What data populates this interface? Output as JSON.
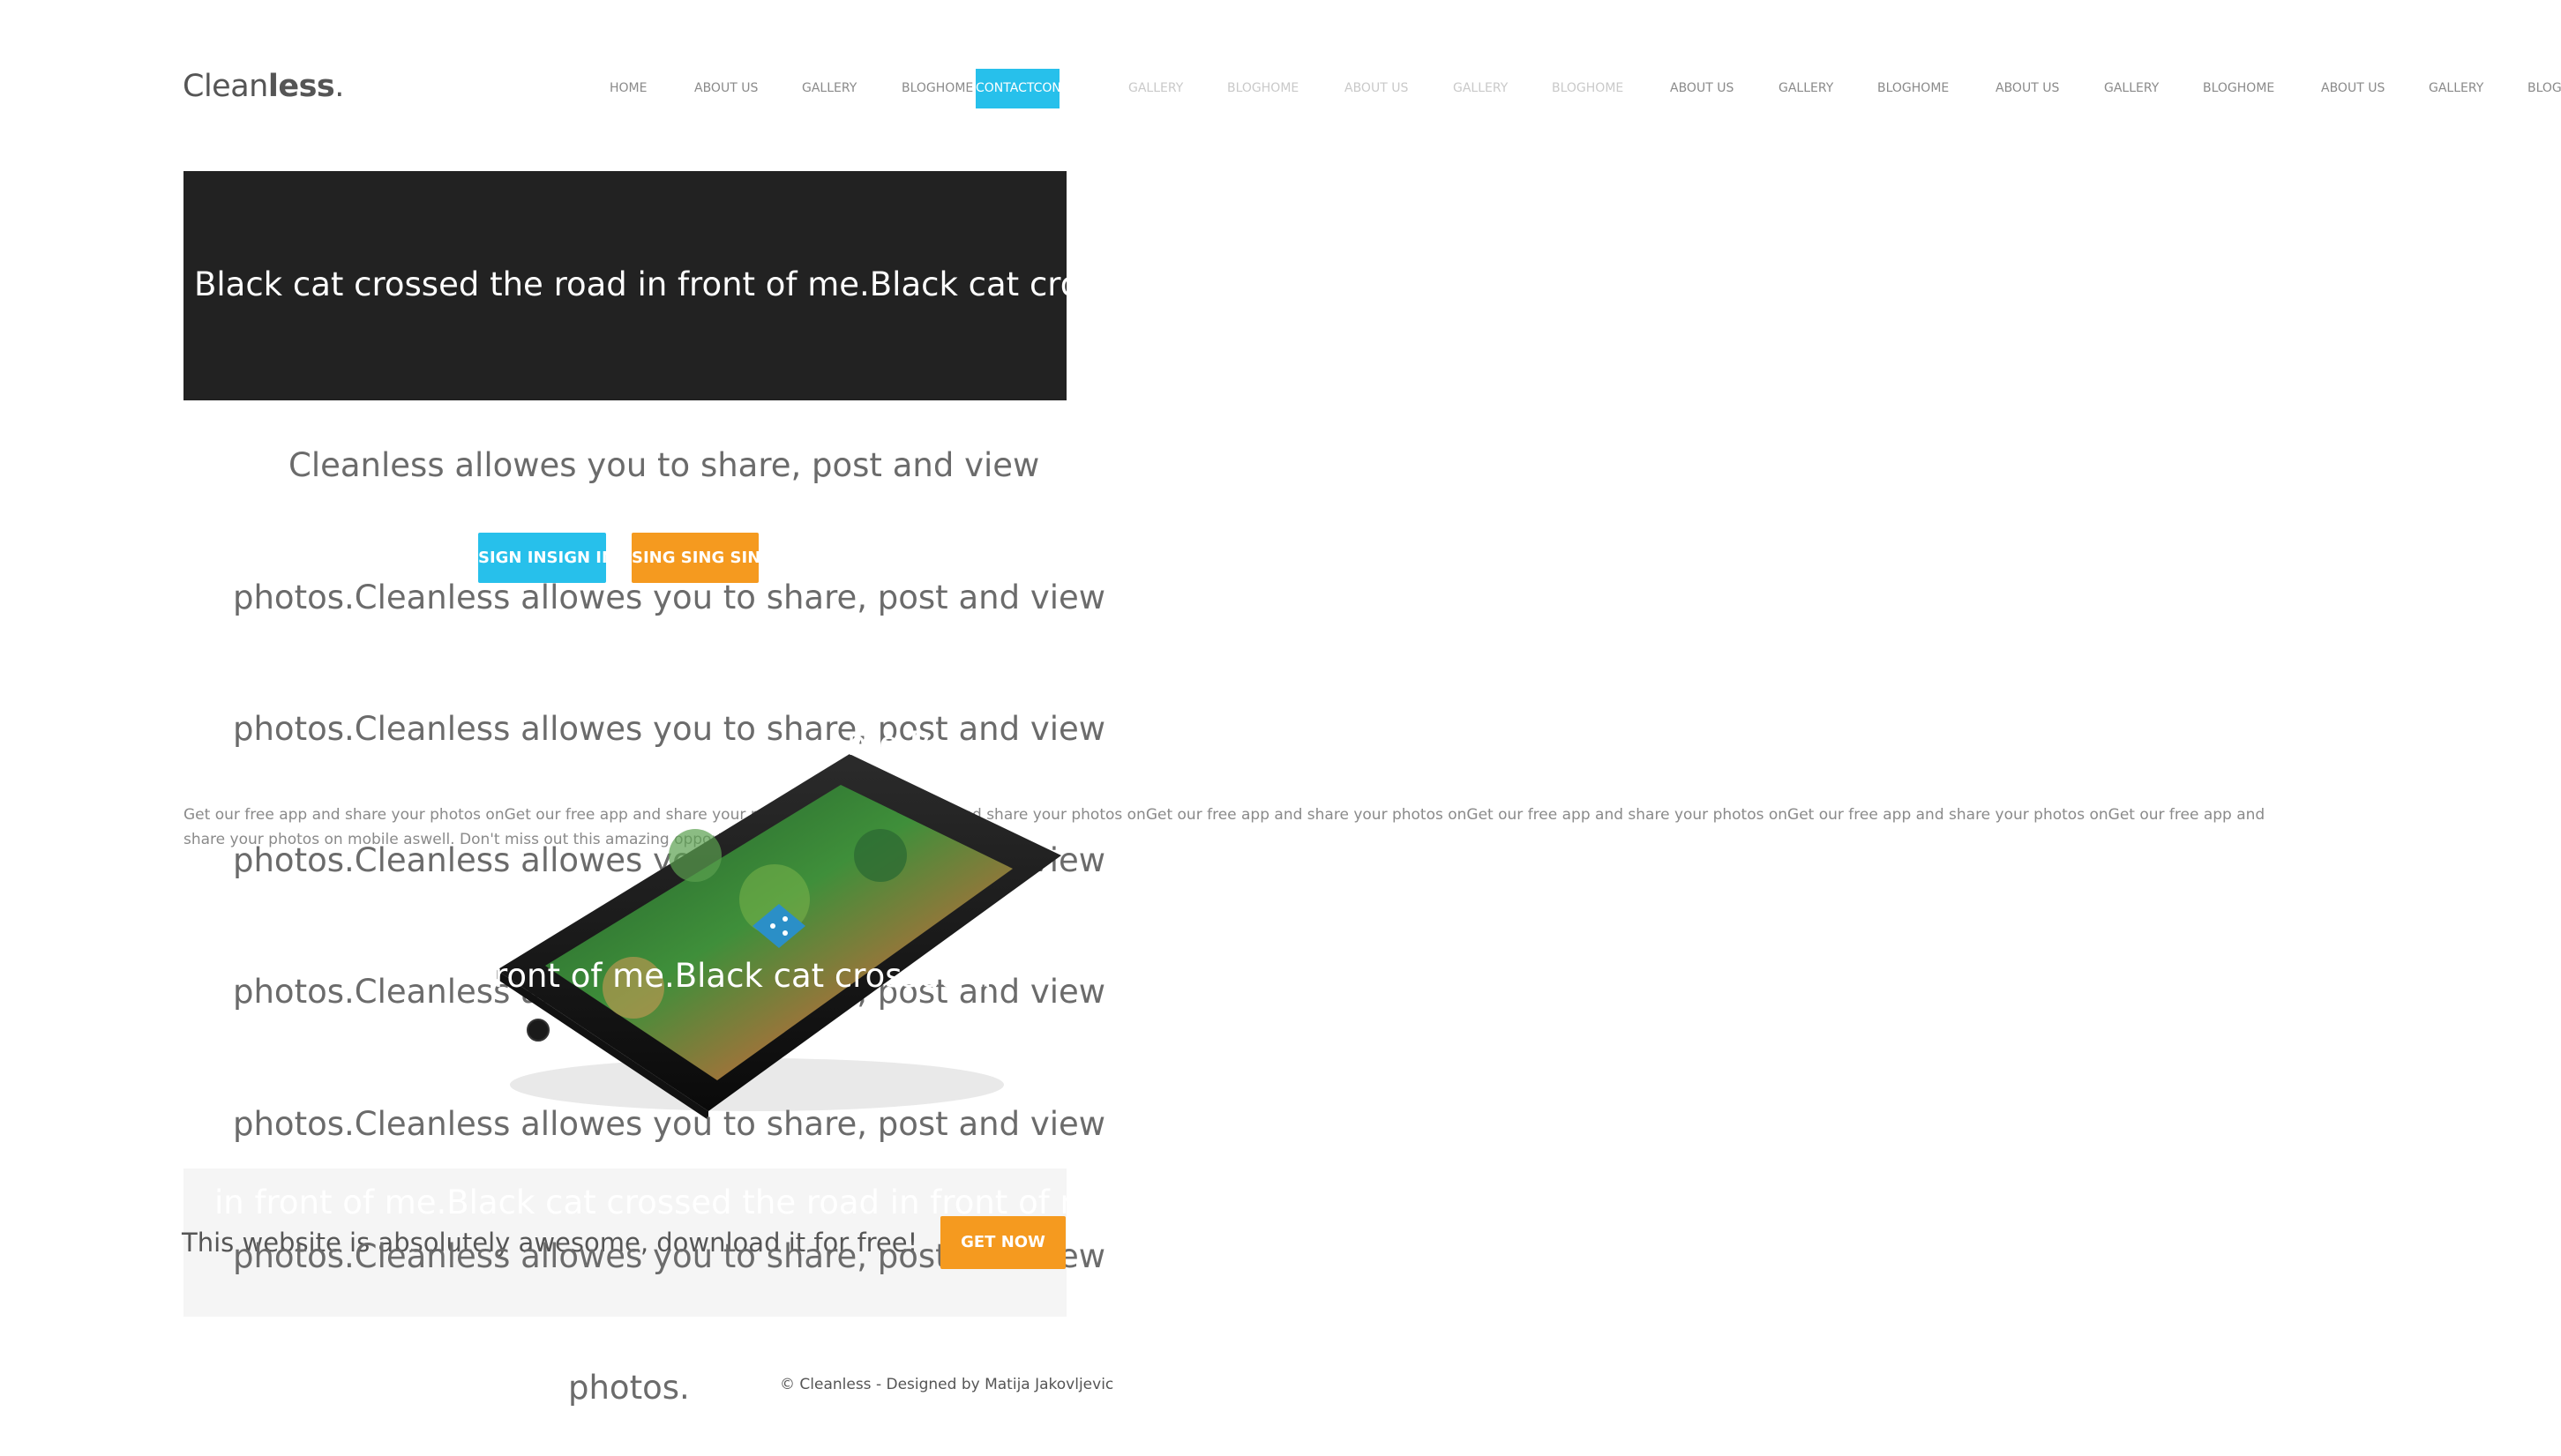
{
  "logo": {
    "light": "Clean",
    "bold": "less",
    "dot": "."
  },
  "nav": {
    "active": "CONTACTCONT",
    "items": [
      "HOME",
      "ABOUT US",
      "GALLERY",
      "BLOGHOME",
      "GALLERY",
      "BLOGHOME",
      "ABOUT US",
      "GALLERY",
      "BLOGHOME",
      "ABOUT US",
      "GALLERY",
      "BLOGHOME",
      "ABOUT US",
      "GALLERY",
      "BLOGHOME",
      "ABOUT US",
      "GALLERY",
      "BLOG"
    ]
  },
  "hero": {
    "text": "Black cat crossed the road in front of me.Black cat crossed"
  },
  "description": {
    "lines": [
      "Cleanless allowes you to share, post and view",
      "photos.Cleanless allowes you to share, post and view",
      "photos.Cleanless allowes you to share, post and view",
      "photos.Cleanless allowes you to share, post and view",
      "photos.Cleanless allowes you to share, post and view",
      "photos.Cleanless allowes you to share, post and view",
      "photos.Cleanless allowes you to share, post and view",
      "photos."
    ]
  },
  "buttons": {
    "sign_in": "SIGN INSIGN INS",
    "sing": "SING SING SING"
  },
  "get_app": {
    "text": "Get our free app and share your photos onGet our free app and share your photos onGet our free app and share your photos onGet our free app and share your photos onGet our free app and share your photos onGet our free app and share your photos onGet our free app and share your photos on mobile aswell. Don't miss out this amazing opportunity. Get now!"
  },
  "overlays": {
    "near_phone_top": "me.B",
    "near_phone_mid": "ront of me.Black cat crossed th",
    "banner_ghost": "in front of me.Black cat crossed the road in front of me."
  },
  "banner": {
    "text": "This website is absolutely awesome, download it for free!",
    "cta": "GET NOW"
  },
  "footer": {
    "text": "© Cleanless - Designed by Matija Jakovljevic"
  },
  "colors": {
    "accent_blue": "#27c0eb",
    "accent_orange": "#f59a1f",
    "hero_bg": "#222222",
    "banner_bg": "#f5f5f5"
  },
  "icons": {
    "share": "share-icon"
  }
}
